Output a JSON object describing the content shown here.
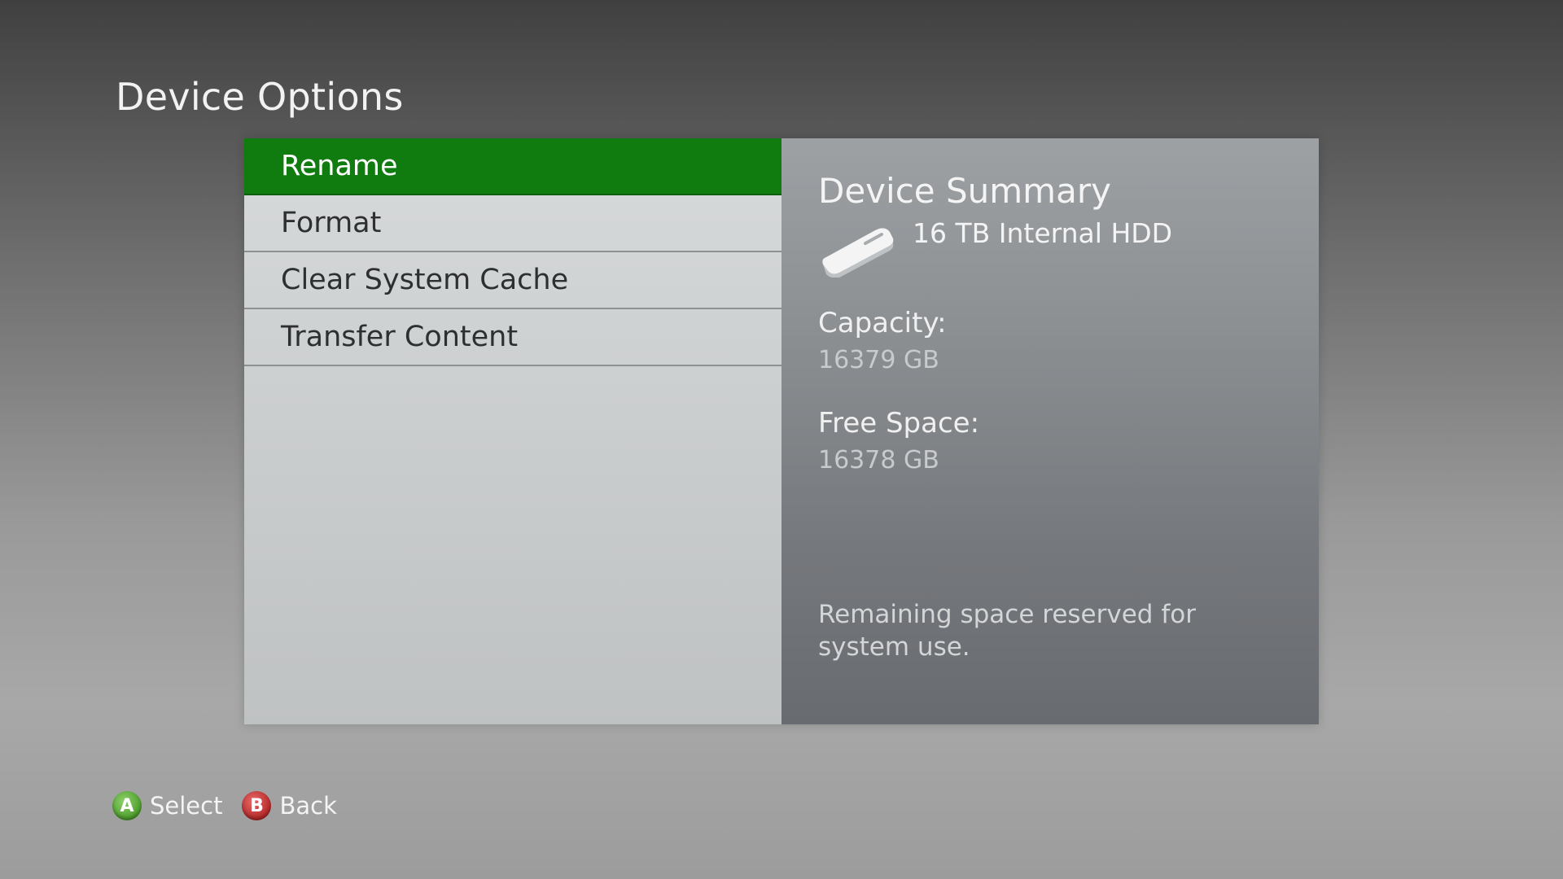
{
  "page": {
    "title": "Device Options"
  },
  "menu": {
    "items": [
      {
        "label": "Rename",
        "selected": true
      },
      {
        "label": "Format",
        "selected": false
      },
      {
        "label": "Clear System Cache",
        "selected": false
      },
      {
        "label": "Transfer Content",
        "selected": false
      }
    ]
  },
  "summary": {
    "title": "Device Summary",
    "device_name": "16 TB Internal HDD",
    "device_icon": "hdd-icon",
    "capacity_label": "Capacity:",
    "capacity_value": "16379 GB",
    "free_label": "Free Space:",
    "free_value": "16378 GB",
    "note": "Remaining space reserved for system use."
  },
  "hints": {
    "select_glyph": "A",
    "select_label": "Select",
    "back_glyph": "B",
    "back_label": "Back"
  },
  "colors": {
    "selected": "#107c10",
    "a_button": "#4c9d2c",
    "b_button": "#b52828"
  }
}
